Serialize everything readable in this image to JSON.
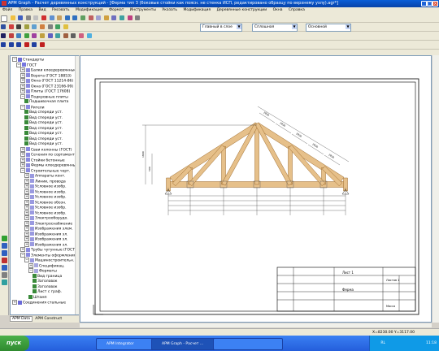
{
  "window": {
    "title": "APM Graph - Расчет деревянных конструкций - [Ферма тип 3 (боковые стойки как поясн. не стенка ИСП, редактировано образцу по верхнему узлу).agr*]"
  },
  "menu": [
    "Файл",
    "Правка",
    "Вид",
    "Рисовать",
    "Модификация",
    "Формат",
    "Инструменты",
    "Указать",
    "Модификация",
    "Деревянные конструкции",
    "Окна",
    "Справка"
  ],
  "toolbar": {
    "layer_combo": "Главный в слое",
    "linetype_combo": "Сплошная",
    "style_combo": "Основной"
  },
  "tree": {
    "items": [
      {
        "label": "Стандарты",
        "level": 0,
        "exp": "−"
      },
      {
        "label": "ГОСТ",
        "level": 1,
        "exp": "−"
      },
      {
        "label": "Балки клеедеревянные",
        "level": 2,
        "exp": "+"
      },
      {
        "label": "Ворота (ГОСТ 18853)",
        "level": 2,
        "exp": "+"
      },
      {
        "label": "Окна (ГОСТ 11214-86)",
        "level": 2,
        "exp": "+"
      },
      {
        "label": "Окна (ГОСТ 23166-99)",
        "level": 2,
        "exp": "+"
      },
      {
        "label": "Плиты (ГОСТ 17608)",
        "level": 2,
        "exp": "+"
      },
      {
        "label": "Подкровные плиты",
        "level": 2,
        "exp": "−"
      },
      {
        "label": "Подшивочная плита",
        "level": 3,
        "exp": ""
      },
      {
        "label": "Ригели",
        "level": 2,
        "exp": "−"
      },
      {
        "label": "Вид спереди уст.",
        "level": 3,
        "exp": ""
      },
      {
        "label": "Вид спереди уст.",
        "level": 3,
        "exp": ""
      },
      {
        "label": "Вид спереди уст.",
        "level": 3,
        "exp": ""
      },
      {
        "label": "Вид спереди уст.",
        "level": 3,
        "exp": ""
      },
      {
        "label": "Вид спереди уст.",
        "level": 3,
        "exp": ""
      },
      {
        "label": "Вид спереди уст.",
        "level": 3,
        "exp": ""
      },
      {
        "label": "Вид спереди уст.",
        "level": 3,
        "exp": ""
      },
      {
        "label": "Сваи колонны (ГОСТ)",
        "level": 2,
        "exp": "+"
      },
      {
        "label": "Сечения по сортаменту",
        "level": 2,
        "exp": "+"
      },
      {
        "label": "Стойки бетонные",
        "level": 2,
        "exp": "+"
      },
      {
        "label": "Фермы клеедеревянные",
        "level": 2,
        "exp": "+"
      },
      {
        "label": "Строительные черт.",
        "level": 2,
        "exp": "−"
      },
      {
        "label": "Аппараты конт.",
        "level": 3,
        "exp": "+"
      },
      {
        "label": "Линии, провода",
        "level": 3,
        "exp": "+"
      },
      {
        "label": "Условное изобр.",
        "level": 3,
        "exp": "+"
      },
      {
        "label": "Условное изобр.",
        "level": 3,
        "exp": "+"
      },
      {
        "label": "Условное изобр.",
        "level": 3,
        "exp": "+"
      },
      {
        "label": "Условное обозн.",
        "level": 3,
        "exp": "+"
      },
      {
        "label": "Условное изобр.",
        "level": 3,
        "exp": "+"
      },
      {
        "label": "Условное изобр.",
        "level": 3,
        "exp": "+"
      },
      {
        "label": "Электрооборудо.",
        "level": 3,
        "exp": "+"
      },
      {
        "label": "Электроснабжение",
        "level": 3,
        "exp": "+"
      },
      {
        "label": "Изображения элем.",
        "level": 3,
        "exp": "+"
      },
      {
        "label": "Изображения эл.",
        "level": 3,
        "exp": "+"
      },
      {
        "label": "Изображения эл.",
        "level": 3,
        "exp": "+"
      },
      {
        "label": "Изображения эл.",
        "level": 3,
        "exp": "+"
      },
      {
        "label": "Трубы чугунные (ГОСТ)",
        "level": 2,
        "exp": "+"
      },
      {
        "label": "Элементы оформления",
        "level": 2,
        "exp": "−"
      },
      {
        "label": "Машиностроительн.",
        "level": 3,
        "exp": "−"
      },
      {
        "label": "Спецификац.",
        "level": 4,
        "exp": "+"
      },
      {
        "label": "Форматы",
        "level": 4,
        "exp": "−"
      },
      {
        "label": "Вид граница",
        "level": 5,
        "exp": ""
      },
      {
        "label": "Заголовок",
        "level": 5,
        "exp": ""
      },
      {
        "label": "Заголовок",
        "level": 5,
        "exp": ""
      },
      {
        "label": "Лист с граф.",
        "level": 5,
        "exp": ""
      },
      {
        "label": "Штамп",
        "level": 4,
        "exp": ""
      },
      {
        "label": "Соединения стальные",
        "level": 0,
        "exp": "+"
      }
    ],
    "tabs": [
      "APM Data",
      "APM Construct"
    ]
  },
  "status": {
    "coords": "X=8230.00 Y=3117.00"
  },
  "taskbar": {
    "start_label": "пуск",
    "tasks": [
      "APM Integrator",
      "APM Graph - Расчет ...",
      ""
    ],
    "tray_lang": "RL",
    "clock": "11:18"
  },
  "drawing": {
    "dims_top": [
      "2830",
      "2830",
      "2830",
      "2830",
      "2830"
    ],
    "dims_left": [
      "500",
      "1800"
    ],
    "title_block_text": [
      "Лист 1",
      "Ферма",
      "Масса",
      "Листов 1"
    ],
    "colors": {
      "wood": "#e6c08a",
      "wood_edge": "#9c6a2c",
      "dim_line": "#333333",
      "accent": "#0842a8"
    }
  }
}
